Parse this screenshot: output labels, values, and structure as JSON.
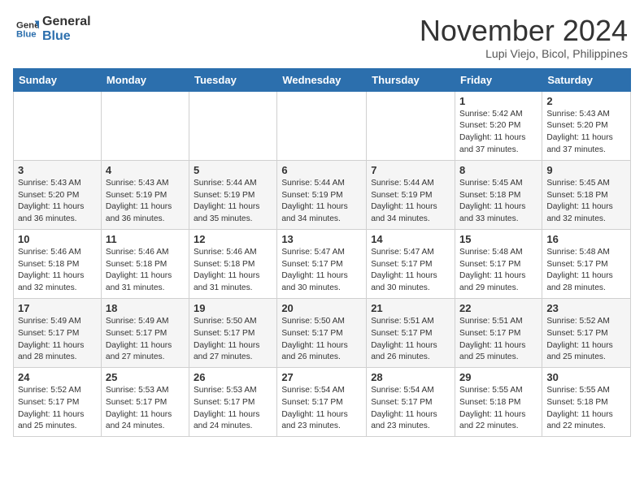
{
  "header": {
    "logo_general": "General",
    "logo_blue": "Blue",
    "month_title": "November 2024",
    "location": "Lupi Viejo, Bicol, Philippines"
  },
  "days_of_week": [
    "Sunday",
    "Monday",
    "Tuesday",
    "Wednesday",
    "Thursday",
    "Friday",
    "Saturday"
  ],
  "weeks": [
    [
      {
        "day": "",
        "info": ""
      },
      {
        "day": "",
        "info": ""
      },
      {
        "day": "",
        "info": ""
      },
      {
        "day": "",
        "info": ""
      },
      {
        "day": "",
        "info": ""
      },
      {
        "day": "1",
        "info": "Sunrise: 5:42 AM\nSunset: 5:20 PM\nDaylight: 11 hours and 37 minutes."
      },
      {
        "day": "2",
        "info": "Sunrise: 5:43 AM\nSunset: 5:20 PM\nDaylight: 11 hours and 37 minutes."
      }
    ],
    [
      {
        "day": "3",
        "info": "Sunrise: 5:43 AM\nSunset: 5:20 PM\nDaylight: 11 hours and 36 minutes."
      },
      {
        "day": "4",
        "info": "Sunrise: 5:43 AM\nSunset: 5:19 PM\nDaylight: 11 hours and 36 minutes."
      },
      {
        "day": "5",
        "info": "Sunrise: 5:44 AM\nSunset: 5:19 PM\nDaylight: 11 hours and 35 minutes."
      },
      {
        "day": "6",
        "info": "Sunrise: 5:44 AM\nSunset: 5:19 PM\nDaylight: 11 hours and 34 minutes."
      },
      {
        "day": "7",
        "info": "Sunrise: 5:44 AM\nSunset: 5:19 PM\nDaylight: 11 hours and 34 minutes."
      },
      {
        "day": "8",
        "info": "Sunrise: 5:45 AM\nSunset: 5:18 PM\nDaylight: 11 hours and 33 minutes."
      },
      {
        "day": "9",
        "info": "Sunrise: 5:45 AM\nSunset: 5:18 PM\nDaylight: 11 hours and 32 minutes."
      }
    ],
    [
      {
        "day": "10",
        "info": "Sunrise: 5:46 AM\nSunset: 5:18 PM\nDaylight: 11 hours and 32 minutes."
      },
      {
        "day": "11",
        "info": "Sunrise: 5:46 AM\nSunset: 5:18 PM\nDaylight: 11 hours and 31 minutes."
      },
      {
        "day": "12",
        "info": "Sunrise: 5:46 AM\nSunset: 5:18 PM\nDaylight: 11 hours and 31 minutes."
      },
      {
        "day": "13",
        "info": "Sunrise: 5:47 AM\nSunset: 5:17 PM\nDaylight: 11 hours and 30 minutes."
      },
      {
        "day": "14",
        "info": "Sunrise: 5:47 AM\nSunset: 5:17 PM\nDaylight: 11 hours and 30 minutes."
      },
      {
        "day": "15",
        "info": "Sunrise: 5:48 AM\nSunset: 5:17 PM\nDaylight: 11 hours and 29 minutes."
      },
      {
        "day": "16",
        "info": "Sunrise: 5:48 AM\nSunset: 5:17 PM\nDaylight: 11 hours and 28 minutes."
      }
    ],
    [
      {
        "day": "17",
        "info": "Sunrise: 5:49 AM\nSunset: 5:17 PM\nDaylight: 11 hours and 28 minutes."
      },
      {
        "day": "18",
        "info": "Sunrise: 5:49 AM\nSunset: 5:17 PM\nDaylight: 11 hours and 27 minutes."
      },
      {
        "day": "19",
        "info": "Sunrise: 5:50 AM\nSunset: 5:17 PM\nDaylight: 11 hours and 27 minutes."
      },
      {
        "day": "20",
        "info": "Sunrise: 5:50 AM\nSunset: 5:17 PM\nDaylight: 11 hours and 26 minutes."
      },
      {
        "day": "21",
        "info": "Sunrise: 5:51 AM\nSunset: 5:17 PM\nDaylight: 11 hours and 26 minutes."
      },
      {
        "day": "22",
        "info": "Sunrise: 5:51 AM\nSunset: 5:17 PM\nDaylight: 11 hours and 25 minutes."
      },
      {
        "day": "23",
        "info": "Sunrise: 5:52 AM\nSunset: 5:17 PM\nDaylight: 11 hours and 25 minutes."
      }
    ],
    [
      {
        "day": "24",
        "info": "Sunrise: 5:52 AM\nSunset: 5:17 PM\nDaylight: 11 hours and 25 minutes."
      },
      {
        "day": "25",
        "info": "Sunrise: 5:53 AM\nSunset: 5:17 PM\nDaylight: 11 hours and 24 minutes."
      },
      {
        "day": "26",
        "info": "Sunrise: 5:53 AM\nSunset: 5:17 PM\nDaylight: 11 hours and 24 minutes."
      },
      {
        "day": "27",
        "info": "Sunrise: 5:54 AM\nSunset: 5:17 PM\nDaylight: 11 hours and 23 minutes."
      },
      {
        "day": "28",
        "info": "Sunrise: 5:54 AM\nSunset: 5:17 PM\nDaylight: 11 hours and 23 minutes."
      },
      {
        "day": "29",
        "info": "Sunrise: 5:55 AM\nSunset: 5:18 PM\nDaylight: 11 hours and 22 minutes."
      },
      {
        "day": "30",
        "info": "Sunrise: 5:55 AM\nSunset: 5:18 PM\nDaylight: 11 hours and 22 minutes."
      }
    ]
  ]
}
